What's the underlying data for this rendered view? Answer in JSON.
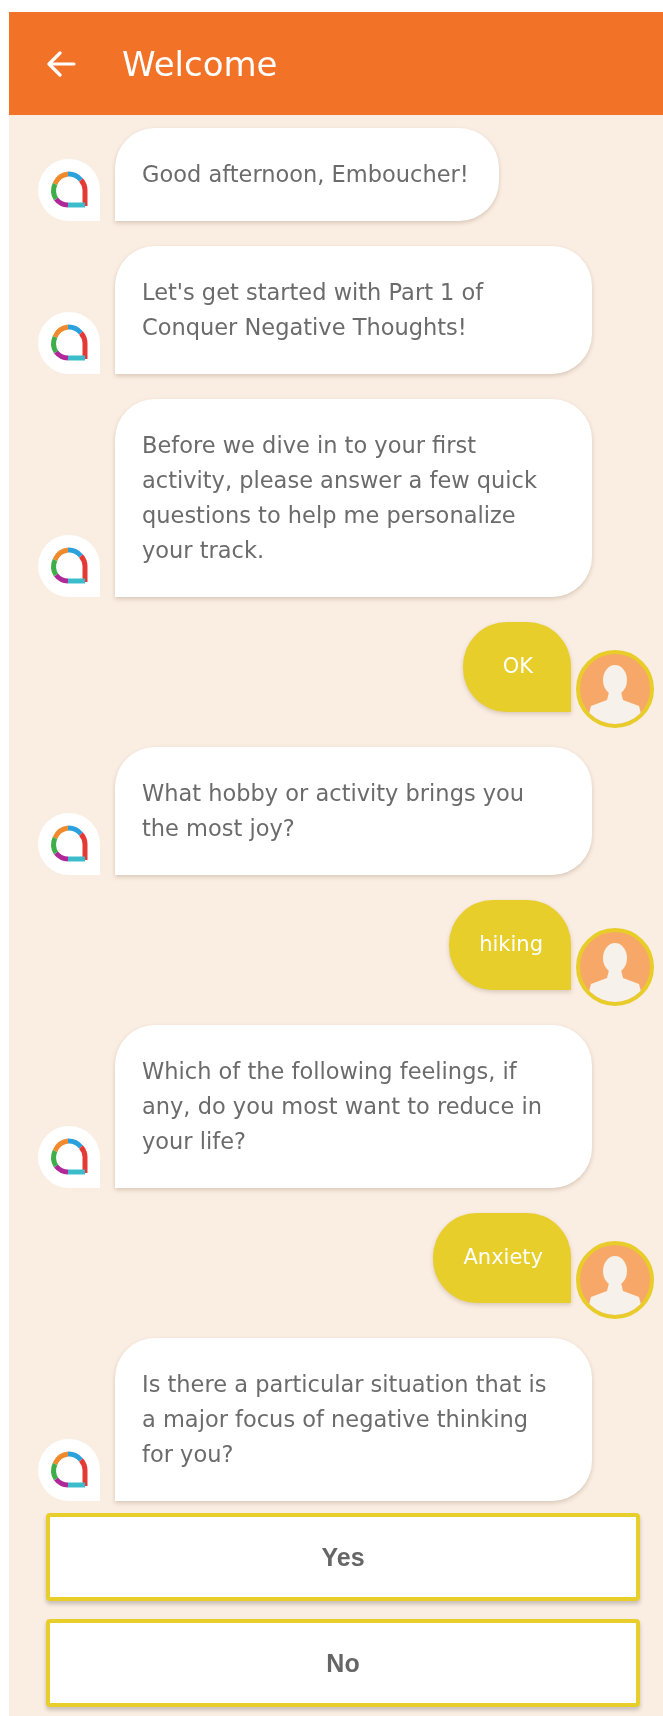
{
  "header": {
    "title": "Welcome"
  },
  "messages": [
    {
      "kind": "bot",
      "text": "Good afternoon, Emboucher!"
    },
    {
      "kind": "bot",
      "text": "Let's get started with Part 1 of Conquer Negative Thoughts!"
    },
    {
      "kind": "bot",
      "text": "Before we dive in to your first activity, please answer a few quick questions to help me personalize your track."
    },
    {
      "kind": "user",
      "text": "OK"
    },
    {
      "kind": "bot",
      "text": "What hobby or activity brings you the most joy?"
    },
    {
      "kind": "user",
      "text": "hiking"
    },
    {
      "kind": "bot",
      "text": "Which of the following feelings, if any, do you most want to reduce in your life?"
    },
    {
      "kind": "user",
      "text": "Anxiety"
    },
    {
      "kind": "bot",
      "text": "Is there a particular situation that is a major focus of negative thinking for you?"
    }
  ],
  "options": [
    {
      "label": "Yes"
    },
    {
      "label": "No"
    }
  ]
}
